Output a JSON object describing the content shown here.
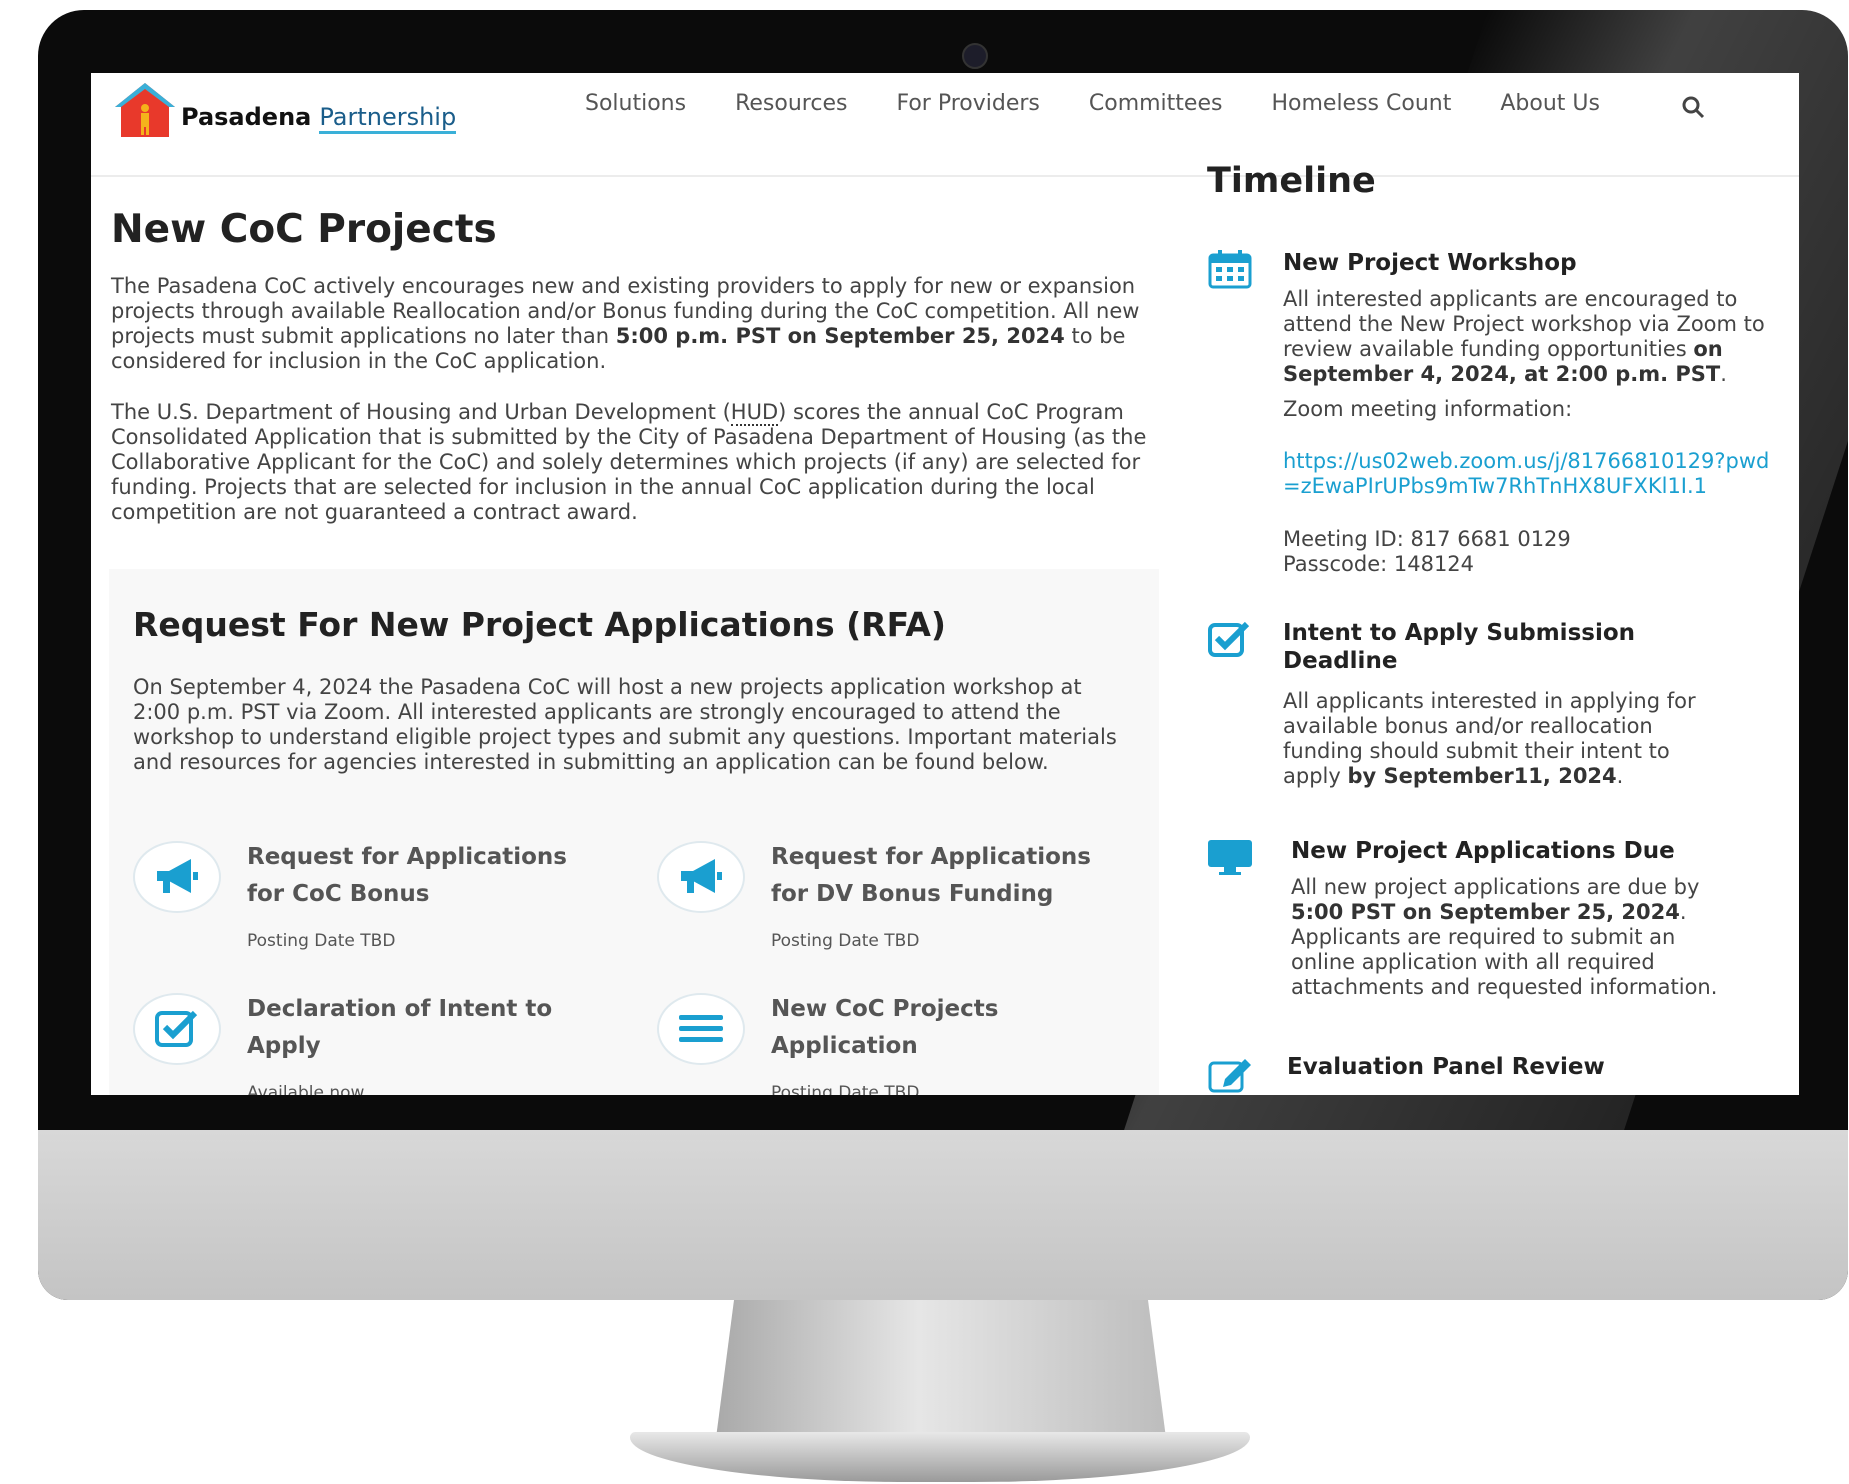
{
  "site": {
    "logo_word1": "Pasadena",
    "logo_word2": "Partnership",
    "nav": [
      "Solutions",
      "Resources",
      "For Providers",
      "Committees",
      "Homeless Count",
      "About Us"
    ]
  },
  "main": {
    "title": "New CoC Projects",
    "p1_a": "The Pasadena CoC actively encourages new and existing providers to apply for new or expansion projects through available Reallocation and/or Bonus funding during the CoC competition. All new projects must submit applications no later than ",
    "p1_b": "5:00 p.m. PST on September 25, 2024",
    "p1_c": " to be considered for inclusion in the CoC application.",
    "p2_a": "The U.S. Department of Housing and Urban Development (",
    "p2_hud": "HUD",
    "p2_b": ") scores the annual CoC Program Consolidated Application that is submitted by the City of Pasadena Department of Housing (as the Collaborative Applicant for the CoC) and solely determines which projects (if any) are selected for funding. Projects that are selected for inclusion in the annual CoC application during the local competition are not guaranteed a contract award."
  },
  "rfa": {
    "title": "Request For New Project Applications (RFA)",
    "desc": "On September 4, 2024 the Pasadena CoC will host a new projects application workshop at 2:00 p.m. PST via Zoom. All interested applicants are strongly encouraged to attend the workshop to understand eligible project types and submit any questions. Important materials and resources for agencies interested in submitting an application can be found below.",
    "items": [
      {
        "title": "Request for Applications for CoC Bonus",
        "sub": "Posting Date TBD",
        "icon": "megaphone-icon"
      },
      {
        "title": "Request for Applications for DV Bonus Funding",
        "sub": "Posting Date TBD",
        "icon": "megaphone-icon"
      },
      {
        "title": "Declaration of Intent to Apply",
        "sub": "Available now",
        "icon": "checkbox-icon"
      },
      {
        "title": "New CoC Projects Application",
        "sub": "Posting Date TBD",
        "icon": "menu-lines-icon"
      }
    ]
  },
  "timeline": {
    "title": "Timeline",
    "workshop_title": "New Project Workshop",
    "workshop_a": "All interested applicants are encouraged to attend the New Project workshop via Zoom to review available funding opportunities ",
    "workshop_b": "on September 4, 2024, at 2:00 p.m. PST",
    "workshop_c": ".",
    "zoom_label": "Zoom meeting information:",
    "zoom_link": "https://us02web.zoom.us/j/81766810129?pwd=zEwaPIrUPbs9mTw7RhTnHX8UFXKl1I.1",
    "meeting_id": "Meeting ID: 817 6681 0129",
    "passcode": "Passcode: 148124",
    "intent_title": "Intent to Apply Submission Deadline",
    "intent_a": "All applicants interested in applying for available bonus and/or reallocation funding should submit their intent to apply ",
    "intent_b": "by September11, 2024",
    "intent_c": ".",
    "due_title": "New Project Applications Due",
    "due_a": "All new project applications are due by ",
    "due_b": "5:00 PST on September 25, 2024",
    "due_c": ". Applicants are required to submit an online application with all required attachments and requested information.",
    "review_title": "Evaluation Panel Review"
  },
  "colors": {
    "accent": "#1a9fd0",
    "logo_red": "#e8392b",
    "logo_blue": "#3ab0d8"
  }
}
